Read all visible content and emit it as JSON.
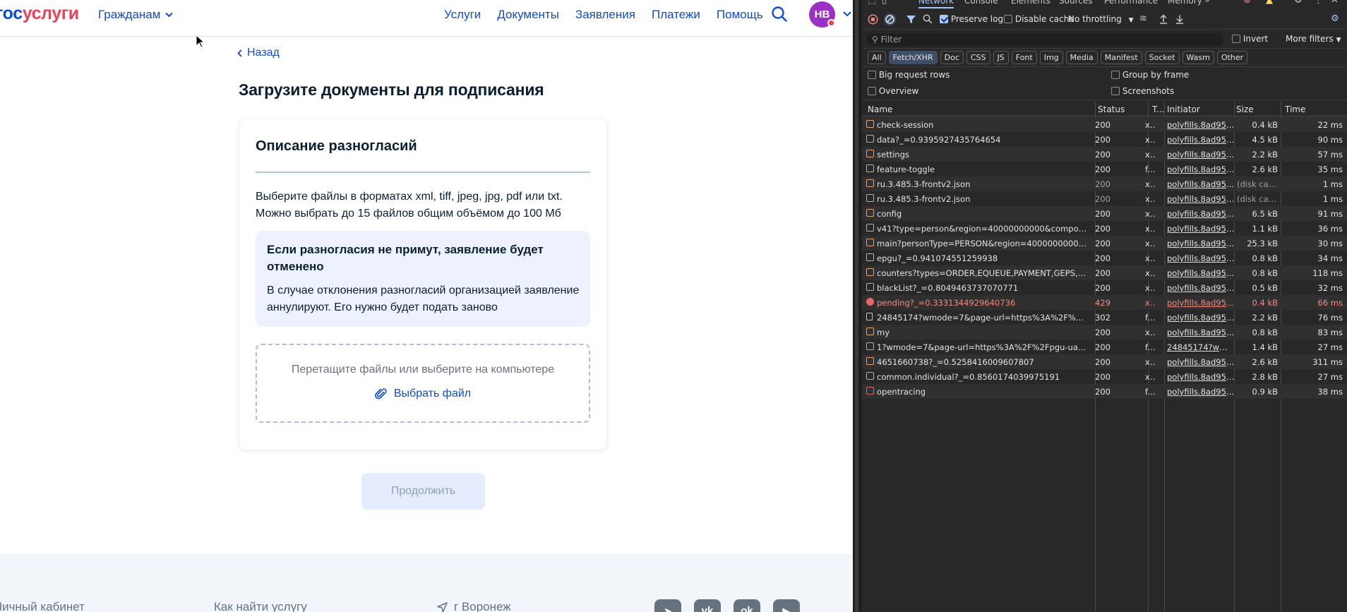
{
  "site": {
    "logo_a": "гос",
    "logo_b": "услуги",
    "citizens": "Гражданам",
    "nav": [
      "Услуги",
      "Документы",
      "Заявления",
      "Платежи",
      "Помощь"
    ],
    "avatar": "НВ",
    "back": "Назад",
    "page_title": "Загрузите документы для подписания",
    "card": {
      "title": "Описание разногласий",
      "desc_line1": "Выберите файлы в форматах xml, tiff, jpeg, jpg, pdf или txt.",
      "desc_line2": "Можно выбрать до 15 файлов общим объёмом до 100 Мб",
      "warning_title": "Если разногласия не примут, заявление будет отменено",
      "warning_text": "В случае отклонения разногласий организацией заявление аннулируют. Его нужно будет подать заново",
      "drop_text": "Перетащите файлы или выберите на компьютере",
      "choose_file": "Выбрать файл"
    },
    "continue": "Продолжить",
    "footer": {
      "cabinet": "Личный кабинет",
      "find_service": "Как найти услугу",
      "city": "г Воронеж"
    }
  },
  "devtools": {
    "tabs": [
      "Network",
      "Console",
      "Elements",
      "Sources",
      "Performance",
      "Memory"
    ],
    "active_tab": "Network",
    "preserve_log": "Preserve log",
    "disable_cache": "Disable cache",
    "throttling": "No throttling",
    "filter_placeholder": "Filter",
    "invert": "Invert",
    "more_filters": "More filters",
    "type_filters": [
      "All",
      "Fetch/XHR",
      "Doc",
      "CSS",
      "JS",
      "Font",
      "Img",
      "Media",
      "Manifest",
      "Socket",
      "Wasm",
      "Other"
    ],
    "active_type": "Fetch/XHR",
    "options": [
      "Big request rows",
      "Group by frame",
      "Overview",
      "Screenshots"
    ],
    "columns": [
      "Name",
      "Status",
      "T...",
      "Initiator",
      "Size",
      "Time"
    ],
    "rows": [
      {
        "name": "check-session",
        "status": "200",
        "type": "x...",
        "initiator": "polyfills.8ad95c48",
        "size": "0.4 kB",
        "time": "22 ms",
        "kind": "xhr"
      },
      {
        "name": "data?_=0.9395927435764654",
        "status": "200",
        "type": "x...",
        "initiator": "polyfills.8ad95c48",
        "size": "4.5 kB",
        "time": "90 ms",
        "kind": "xhr"
      },
      {
        "name": "settings",
        "status": "200",
        "type": "x...",
        "initiator": "polyfills.8ad95c48",
        "size": "2.2 kB",
        "time": "57 ms",
        "kind": "xhr"
      },
      {
        "name": "feature-toggle",
        "status": "200",
        "type": "f...",
        "initiator": "polyfills.8ad95c48",
        "size": "2.6 kB",
        "time": "35 ms",
        "kind": "xhr"
      },
      {
        "name": "ru.3.485.3-frontv2.json",
        "status": "200",
        "type": "x...",
        "initiator": "polyfills.8ad95c48",
        "size": "(disk cac...",
        "time": "1 ms",
        "kind": "xhr",
        "dim": true
      },
      {
        "name": "ru.3.485.3-frontv2.json",
        "status": "200",
        "type": "x...",
        "initiator": "polyfills.8ad95c48",
        "size": "(disk cac...",
        "time": "1 ms",
        "kind": "xhr",
        "dim": true
      },
      {
        "name": "config",
        "status": "200",
        "type": "x...",
        "initiator": "polyfills.8ad95c48",
        "size": "6.5 kB",
        "time": "91 ms",
        "kind": "xhr"
      },
      {
        "name": "v41?type=person&region=40000000000&component...",
        "status": "200",
        "type": "x...",
        "initiator": "polyfills.8ad95c48",
        "size": "1.1 kB",
        "time": "36 ms",
        "kind": "xhr"
      },
      {
        "name": "main?personType=PERSON&region=40000000000&_...",
        "status": "200",
        "type": "x...",
        "initiator": "polyfills.8ad95c48",
        "size": "25.3 kB",
        "time": "30 ms",
        "kind": "xhr"
      },
      {
        "name": "epgu?_=0.941074551259938",
        "status": "200",
        "type": "x...",
        "initiator": "polyfills.8ad95c48",
        "size": "0.8 kB",
        "time": "34 ms",
        "kind": "xhr"
      },
      {
        "name": "counters?types=ORDER,EQUEUE,PAYMENT,GEPS,BIOM...",
        "status": "200",
        "type": "x...",
        "initiator": "polyfills.8ad95c48",
        "size": "0.8 kB",
        "time": "118 ms",
        "kind": "xhr"
      },
      {
        "name": "blackList?_=0.8049463737070771",
        "status": "200",
        "type": "x...",
        "initiator": "polyfills.8ad95c48",
        "size": "0.5 kB",
        "time": "32 ms",
        "kind": "xhr"
      },
      {
        "name": "pending?_=0.3331344929640736",
        "status": "429",
        "type": "x...",
        "initiator": "polyfills.8ad95c48",
        "size": "0.4 kB",
        "time": "66 ms",
        "kind": "err"
      },
      {
        "name": "24845174?wmode=7&page-url=https%3A%2F%2Fpg...",
        "status": "302",
        "type": "f...",
        "initiator": "polyfills.8ad95c48",
        "size": "2.2 kB",
        "time": "76 ms",
        "kind": "doc"
      },
      {
        "name": "my",
        "status": "200",
        "type": "x...",
        "initiator": "polyfills.8ad95c48",
        "size": "0.8 kB",
        "time": "83 ms",
        "kind": "xhr"
      },
      {
        "name": "1?wmode=7&page-url=https%3A%2F%2Fpgu-uat-be...",
        "status": "200",
        "type": "f...",
        "initiator": "24845174?wmode",
        "size": "1.4 kB",
        "time": "27 ms",
        "kind": "xhr"
      },
      {
        "name": "4651660738?_=0.5258416009607807",
        "status": "200",
        "type": "x...",
        "initiator": "polyfills.8ad95c48",
        "size": "2.6 kB",
        "time": "311 ms",
        "kind": "xhr"
      },
      {
        "name": "common.individual?_=0.8560174039975191",
        "status": "200",
        "type": "x...",
        "initiator": "polyfills.8ad95c48",
        "size": "2.8 kB",
        "time": "27 ms",
        "kind": "xhr"
      },
      {
        "name": "opentracing",
        "status": "200",
        "type": "f...",
        "initiator": "polyfills.8ad95c48",
        "size": "0.9 kB",
        "time": "38 ms",
        "kind": "tr"
      }
    ]
  }
}
